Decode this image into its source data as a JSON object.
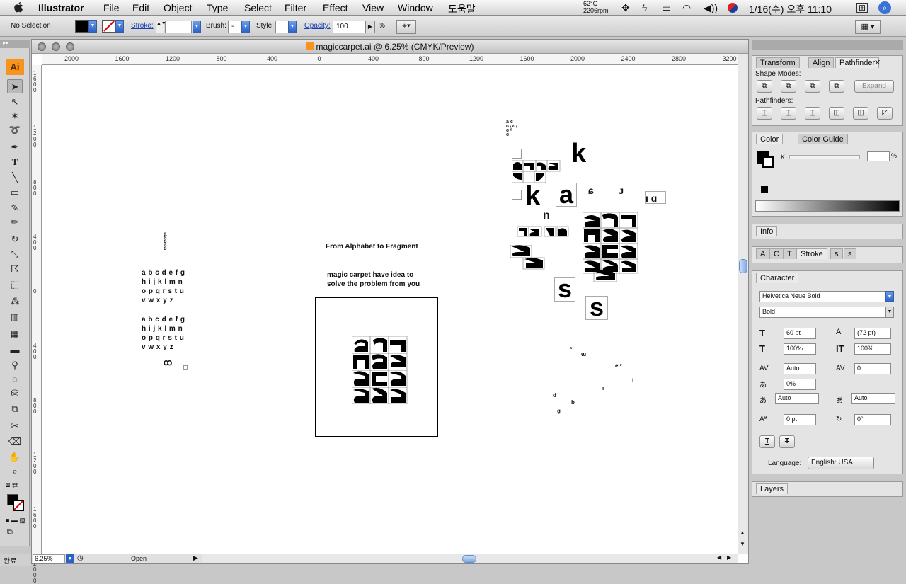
{
  "menubar": {
    "app": "Illustrator",
    "items": [
      "File",
      "Edit",
      "Object",
      "Type",
      "Select",
      "Filter",
      "Effect",
      "View",
      "Window",
      "도움말"
    ],
    "temp": "62°C",
    "rpm": "2206rpm",
    "clock": "1/16(수) 오후 11:10"
  },
  "control": {
    "selection": "No Selection",
    "stroke_label": "Stroke:",
    "brush_label": "Brush:",
    "brush_value": "-",
    "style_label": "Style:",
    "opacity_label": "Opacity:",
    "opacity_value": "100",
    "percent": "%"
  },
  "toolbox": {
    "logo": "Ai",
    "tools": [
      "selection-tool",
      "direct-selection-tool",
      "magic-wand-tool",
      "lasso-tool",
      "pen-tool",
      "type-tool",
      "line-tool",
      "rectangle-tool",
      "paintbrush-tool",
      "pencil-tool",
      "rotate-tool",
      "scale-tool",
      "warp-tool",
      "free-transform-tool",
      "symbol-sprayer-tool",
      "column-graph-tool",
      "mesh-tool",
      "gradient-tool",
      "eyedropper-tool",
      "blend-tool",
      "live-paint-tool",
      "live-paint-selection-tool",
      "slice-tool",
      "eraser-tool",
      "hand-tool",
      "zoom-tool"
    ]
  },
  "document": {
    "title": "magiccarpet.ai @ 6.25% (CMYK/Preview)",
    "ruler_top": [
      "2000",
      "1600",
      "1200",
      "800",
      "400",
      "0",
      "400",
      "800",
      "1200",
      "1600",
      "2000",
      "2400",
      "2800",
      "3200"
    ],
    "ruler_left": [
      "1600",
      "1200",
      "800",
      "400",
      "0",
      "400",
      "800",
      "1200",
      "1600",
      "2000"
    ],
    "zoom": "6.25%",
    "status": "Open",
    "left_alpha_1": [
      "a b c d e f g",
      "h i j k l m n",
      "o p q r s t u",
      "v w x y z"
    ],
    "left_alpha_2": [
      "a b c d e f g",
      "h i j k l m n",
      "o p q r s t u",
      "v w x y z"
    ],
    "heading": "From Alphabet to Fragment",
    "sub_line1": "magic carpet have idea to",
    "sub_line2": "solve the problem from you",
    "big_k1": "k",
    "big_k2": "k",
    "big_a": "a",
    "big_s1": "s",
    "big_s2": "s"
  },
  "panels": {
    "pathfinder": {
      "tabs": [
        "Transform",
        "Align",
        "Pathfinder"
      ],
      "shape_modes_label": "Shape Modes:",
      "pathfinders_label": "Pathfinders:",
      "expand": "Expand"
    },
    "color": {
      "tabs": [
        "Color",
        "Color Guide"
      ],
      "channel": "K",
      "percent": "%"
    },
    "info": {
      "tabs": [
        "Info"
      ]
    },
    "stroke": {
      "tabs": [
        "A",
        "C",
        "T",
        "Stroke",
        "s",
        "s"
      ]
    },
    "character": {
      "tabs": [
        "Character"
      ],
      "font": "Helvetica Neue Bold",
      "style": "Bold",
      "size": "60 pt",
      "leading": "(72 pt)",
      "hscale": "100%",
      "vscale": "100%",
      "kerning": "Auto",
      "tracking": "0",
      "tsume": "0%",
      "aki_left": "Auto",
      "aki_right": "Auto",
      "baseline": "0 pt",
      "rotation": "0°",
      "language_label": "Language:",
      "language": "English: USA"
    },
    "layers": {
      "tabs": [
        "Layers"
      ]
    }
  },
  "bottom": {
    "done_label": "완료"
  },
  "colors": {
    "accent": "#2a62c9",
    "logo_bg": "#f7941d"
  }
}
